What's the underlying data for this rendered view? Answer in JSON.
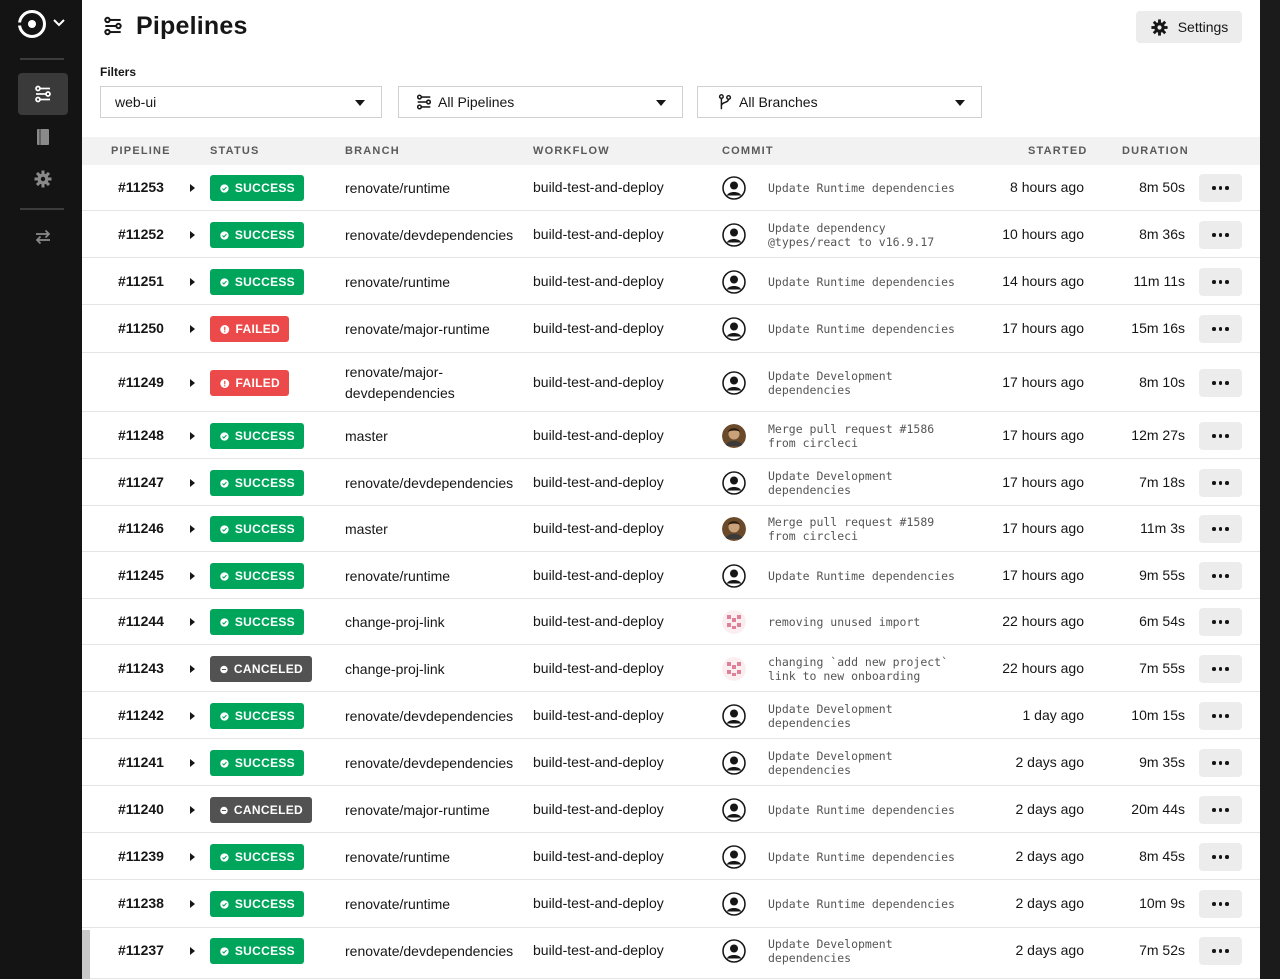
{
  "header": {
    "title": "Pipelines",
    "settings_label": "Settings"
  },
  "filters": {
    "label": "Filters",
    "project": "web-ui",
    "pipelines": "All Pipelines",
    "branches": "All Branches"
  },
  "columns": {
    "pipeline": "PIPELINE",
    "status": "STATUS",
    "branch": "BRANCH",
    "workflow": "WORKFLOW",
    "commit": "COMMIT",
    "started": "STARTED",
    "duration": "DURATION"
  },
  "colors": {
    "success": "#00a55c",
    "failed": "#ec4a4a",
    "canceled": "#525252"
  },
  "rows": [
    {
      "id": "#11253",
      "status": "success",
      "status_label": "SUCCESS",
      "branch": "renovate/runtime",
      "workflow": "build-test-and-deploy",
      "commit": "Update Runtime dependencies",
      "avatar": "default",
      "started": "8 hours ago",
      "duration": "8m 50s"
    },
    {
      "id": "#11252",
      "status": "success",
      "status_label": "SUCCESS",
      "branch": "renovate/devdependencies",
      "workflow": "build-test-and-deploy",
      "commit": "Update dependency\n@types/react to v16.9.17",
      "avatar": "default",
      "started": "10 hours ago",
      "duration": "8m 36s"
    },
    {
      "id": "#11251",
      "status": "success",
      "status_label": "SUCCESS",
      "branch": "renovate/runtime",
      "workflow": "build-test-and-deploy",
      "commit": "Update Runtime dependencies",
      "avatar": "default",
      "started": "14 hours ago",
      "duration": "11m 11s"
    },
    {
      "id": "#11250",
      "status": "failed",
      "status_label": "FAILED",
      "branch": "renovate/major-runtime",
      "workflow": "build-test-and-deploy",
      "commit": "Update Runtime dependencies",
      "avatar": "default",
      "started": "17 hours ago",
      "duration": "15m 16s"
    },
    {
      "id": "#11249",
      "status": "failed",
      "status_label": "FAILED",
      "branch": "renovate/major-\ndevdependencies",
      "workflow": "build-test-and-deploy",
      "commit": "Update Development\ndependencies",
      "avatar": "default",
      "started": "17 hours ago",
      "duration": "8m 10s"
    },
    {
      "id": "#11248",
      "status": "success",
      "status_label": "SUCCESS",
      "branch": "master",
      "workflow": "build-test-and-deploy",
      "commit": "Merge pull request #1586\nfrom circleci",
      "avatar": "photo",
      "started": "17 hours ago",
      "duration": "12m 27s"
    },
    {
      "id": "#11247",
      "status": "success",
      "status_label": "SUCCESS",
      "branch": "renovate/devdependencies",
      "workflow": "build-test-and-deploy",
      "commit": "Update Development\ndependencies",
      "avatar": "default",
      "started": "17 hours ago",
      "duration": "7m 18s"
    },
    {
      "id": "#11246",
      "status": "success",
      "status_label": "SUCCESS",
      "branch": "master",
      "workflow": "build-test-and-deploy",
      "commit": "Merge pull request #1589\nfrom circleci",
      "avatar": "photo",
      "started": "17 hours ago",
      "duration": "11m 3s"
    },
    {
      "id": "#11245",
      "status": "success",
      "status_label": "SUCCESS",
      "branch": "renovate/runtime",
      "workflow": "build-test-and-deploy",
      "commit": "Update Runtime dependencies",
      "avatar": "default",
      "started": "17 hours ago",
      "duration": "9m 55s"
    },
    {
      "id": "#11244",
      "status": "success",
      "status_label": "SUCCESS",
      "branch": "change-proj-link",
      "workflow": "build-test-and-deploy",
      "commit": "removing unused import",
      "avatar": "identicon",
      "started": "22 hours ago",
      "duration": "6m 54s"
    },
    {
      "id": "#11243",
      "status": "canceled",
      "status_label": "CANCELED",
      "branch": "change-proj-link",
      "workflow": "build-test-and-deploy",
      "commit": "changing `add new project`\nlink to new onboarding",
      "avatar": "identicon",
      "started": "22 hours ago",
      "duration": "7m 55s"
    },
    {
      "id": "#11242",
      "status": "success",
      "status_label": "SUCCESS",
      "branch": "renovate/devdependencies",
      "workflow": "build-test-and-deploy",
      "commit": "Update Development\ndependencies",
      "avatar": "default",
      "started": "1 day ago",
      "duration": "10m 15s"
    },
    {
      "id": "#11241",
      "status": "success",
      "status_label": "SUCCESS",
      "branch": "renovate/devdependencies",
      "workflow": "build-test-and-deploy",
      "commit": "Update Development\ndependencies",
      "avatar": "default",
      "started": "2 days ago",
      "duration": "9m 35s"
    },
    {
      "id": "#11240",
      "status": "canceled",
      "status_label": "CANCELED",
      "branch": "renovate/major-runtime",
      "workflow": "build-test-and-deploy",
      "commit": "Update Runtime dependencies",
      "avatar": "default",
      "started": "2 days ago",
      "duration": "20m 44s"
    },
    {
      "id": "#11239",
      "status": "success",
      "status_label": "SUCCESS",
      "branch": "renovate/runtime",
      "workflow": "build-test-and-deploy",
      "commit": "Update Runtime dependencies",
      "avatar": "default",
      "started": "2 days ago",
      "duration": "8m 45s"
    },
    {
      "id": "#11238",
      "status": "success",
      "status_label": "SUCCESS",
      "branch": "renovate/runtime",
      "workflow": "build-test-and-deploy",
      "commit": "Update Runtime dependencies",
      "avatar": "default",
      "started": "2 days ago",
      "duration": "10m 9s"
    },
    {
      "id": "#11237",
      "status": "success",
      "status_label": "SUCCESS",
      "branch": "renovate/devdependencies",
      "workflow": "build-test-and-deploy",
      "commit": "Update Development\ndependencies",
      "avatar": "default",
      "started": "2 days ago",
      "duration": "7m 52s"
    }
  ]
}
